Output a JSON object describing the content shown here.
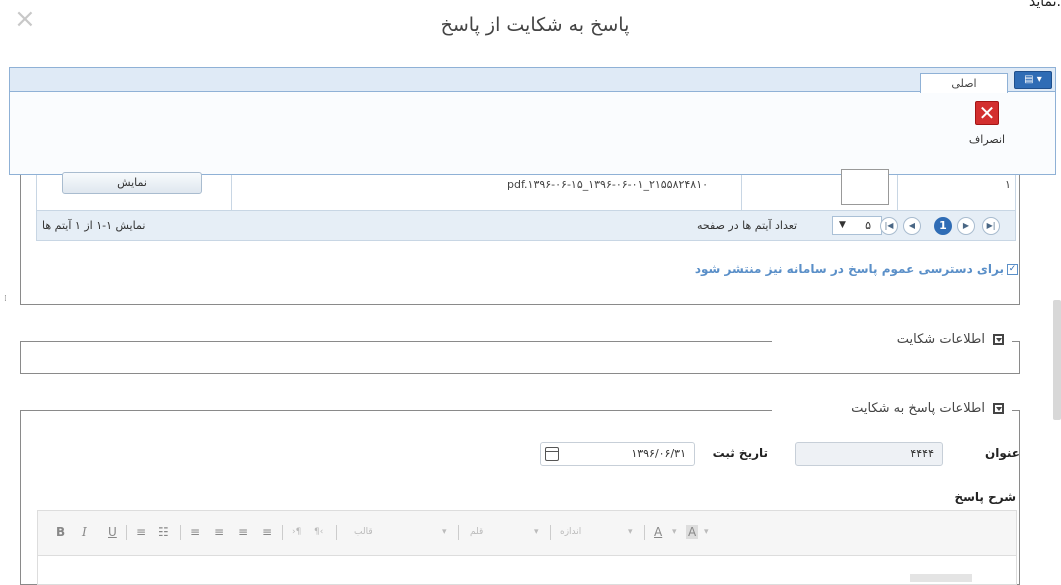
{
  "dialog": {
    "title": "پاسخ به شکایت از پاسخ",
    "close_glyph": "×",
    "top_clip_text": "نماید."
  },
  "ribbon": {
    "menu_glyph": "▤ ▾",
    "tab_main": "اصلی",
    "cancel_label": "انصراف",
    "cancel_icon": "close-icon"
  },
  "attachments": {
    "row": {
      "index": "۱",
      "file_name": "pdf.۱۳۹۶-۰۶-۱۵_۱۳۹۶-۰۶-۰۱_۲۱۵۵۸۲۴۸۱۰",
      "show_button": "نمایش"
    },
    "pager": {
      "info": "نمایش ۱-۱ از ۱ آیتم ها",
      "items_per_page_label": "تعداد آیتم ها در صفحه",
      "page_size": "۵",
      "current_page": "1",
      "first_glyph": "|◀",
      "prev_glyph": "◀",
      "next_glyph": "▶",
      "last_glyph": "▶|"
    },
    "publish_checkbox_label": "برای دسترسی عموم پاسخ در سامانه نیز منتشر شود",
    "publish_checked": true
  },
  "complaint_info": {
    "legend": "اطلاعات شکایت"
  },
  "response_info": {
    "legend": "اطلاعات پاسخ به شکایت",
    "title_label": "عنوان",
    "title_value": "۴۴۴۴",
    "date_label": "تاریخ ثبت",
    "date_value": "۱۳۹۶/۰۶/۳۱",
    "description_label": "شرح پاسخ"
  },
  "editor_toolbar": {
    "bold": "B",
    "italic": "I",
    "underline": "U",
    "ordered_list": "≡",
    "bullet_list": "☷",
    "align_left": "≡",
    "align_center": "≡",
    "align_right": "≡",
    "justify": "≡",
    "ltr": "›¶",
    "rtl": "¶‹",
    "format_placeholder": "قالب",
    "font_placeholder": "قلم",
    "size_placeholder": "اندازه",
    "font_color": "A",
    "bg_color": "A",
    "dropdown": "▾"
  },
  "colors": {
    "accent": "#2f6cb5",
    "link_blue": "#5a8fc8",
    "cancel_red": "#d32f2f"
  }
}
